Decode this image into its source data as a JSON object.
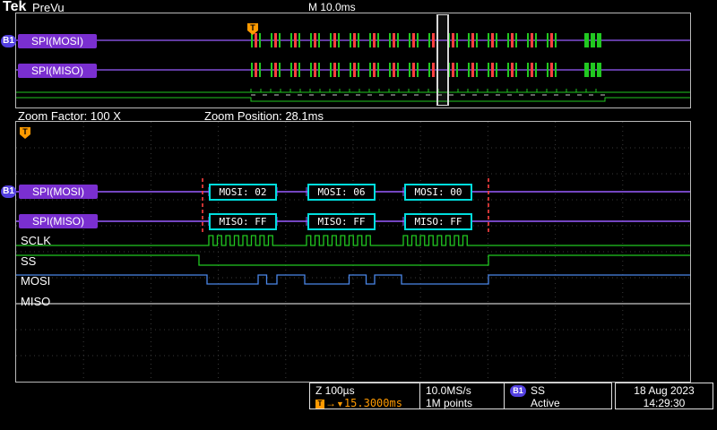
{
  "header": {
    "logo": "Tek",
    "status": "PreVu",
    "timebase": "M 10.0ms"
  },
  "overview": {
    "b1_badge": "B1",
    "bus1_label": "SPI(MOSI)",
    "bus2_label": "SPI(MISO)",
    "trigger_marker": "T"
  },
  "zoom_info": {
    "factor": "Zoom Factor: 100 X",
    "position": "Zoom Position: 28.1ms"
  },
  "zoom": {
    "b1_badge": "B1",
    "trigger_flag": "T",
    "bus1_label": "SPI(MOSI)",
    "bus2_label": "SPI(MISO)",
    "digital_labels": [
      "SCLK",
      "SS",
      "MOSI",
      "MISO"
    ],
    "mosi_decodes": [
      "MOSI: 02",
      "MOSI: 06",
      "MOSI: 00"
    ],
    "miso_decodes": [
      "MISO: FF",
      "MISO: FF",
      "MISO: FF"
    ]
  },
  "status_bar": {
    "zoom_scale": "Z 100µs",
    "trigger_flag": "T",
    "delay_arrow": "→",
    "delay_caret": "▼",
    "delay_readout": "15.3000ms",
    "sample_rate": "10.0MS/s",
    "record_length": "1M points",
    "b1_badge": "B1",
    "trigger_source": "SS",
    "trigger_state": "Active",
    "date": "18 Aug 2023",
    "time": "14:29:30"
  },
  "colors": {
    "bus_violet": "#9a5cff",
    "decode_cyan": "#00dede",
    "digital_green": "#21c821",
    "mosi_blue": "#4a86e8",
    "miso_white": "#c8c8c8",
    "mark_red": "#ff4040",
    "trigger_orange": "#ff9a00",
    "grid_gray": "#3a3a3a"
  }
}
